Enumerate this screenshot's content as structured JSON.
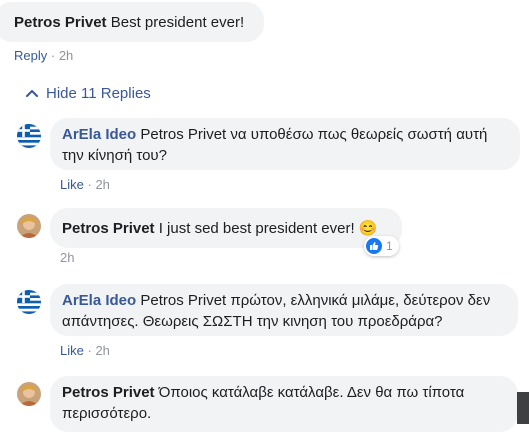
{
  "comment": {
    "author": "Petros Privet",
    "text": "Best president ever!",
    "reply_label": "Reply",
    "time": "2h"
  },
  "hide_replies_label": "Hide 11 Replies",
  "replies": [
    {
      "author": "ArEla Ideo",
      "mention": "Petros Privet",
      "text": "να υποθέσω πως θεωρείς σωστή αυτή την κίνησή του?",
      "action": "Like",
      "time": "2h",
      "avatar": "greek-flag"
    },
    {
      "author": "Petros Privet",
      "text": "I just sed best president ever!",
      "emoji": "😊",
      "time": "2h",
      "reaction_count": "1",
      "avatar": "photo"
    },
    {
      "author": "ArEla Ideo",
      "mention": "Petros Privet",
      "text": "πρώτον, ελληνικά μιλάμε, δεύτερον δεν απάντησες. Θεωρεις ΣΩΣΤΗ την κινηση του προεδράρα?",
      "action": "Like",
      "time": "2h",
      "avatar": "greek-flag"
    },
    {
      "author": "Petros Privet",
      "text": "Όποιος κατάλαβε κατάλαβε. Δεν θα πω τίποτα περισσότερο.",
      "avatar": "photo"
    }
  ],
  "colors": {
    "bubble": "#f2f3f5",
    "link": "#385898",
    "meta": "#90949c",
    "like_blue": "#1877f2"
  }
}
